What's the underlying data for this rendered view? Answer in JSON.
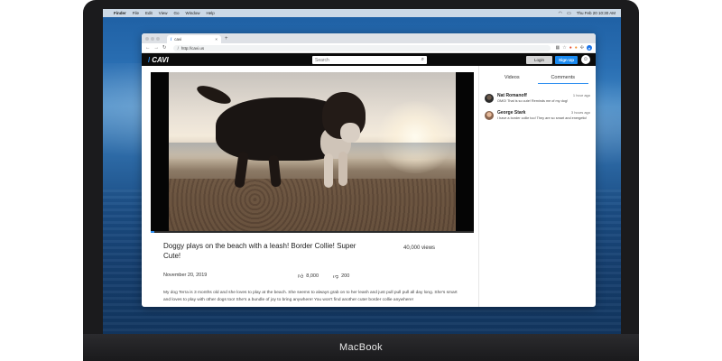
{
  "menubar": {
    "items": [
      "Finder",
      "File",
      "Edit",
      "View",
      "Go",
      "Window",
      "Help"
    ],
    "clock": "Thu Feb 20  10:30 AM"
  },
  "browser": {
    "tab_title": "cavi",
    "address": "http://cavi.us"
  },
  "site": {
    "logo": "CAVI",
    "search_placeholder": "Search",
    "login_label": "Login",
    "signup_label": "Sign Up"
  },
  "video": {
    "title": "Doggy plays on the beach with a leash! Border Collie! Super Cute!",
    "views": "40,000 views",
    "date": "November 20, 2019",
    "likes": "8,000",
    "dislikes": "200",
    "progress": 0.01,
    "description": "My dog Terra is 3 months old and she loves to play at the beach. She seems to always grab on to her leash and just pull pull pull all day long. She's smart and loves to play with other dogs too! She's a bundle of joy to bring anywhere! You won't find another cuter border collie anywhere!"
  },
  "sidebar": {
    "tabs": [
      "Videos",
      "Comments"
    ],
    "active_tab": "Comments",
    "comments": [
      {
        "name": "Nat Romanoff",
        "time": "1 hour ago",
        "text": "OMG! That is so cute! Reminds me of my dog!"
      },
      {
        "name": "George Stark",
        "time": "3 hours ago",
        "text": "I have a border collie too! They are so smart and energetic!"
      }
    ]
  },
  "device": {
    "brand": "MacBook"
  },
  "colors": {
    "accent": "#1a8af0",
    "header_bg": "#0b0b0b"
  }
}
